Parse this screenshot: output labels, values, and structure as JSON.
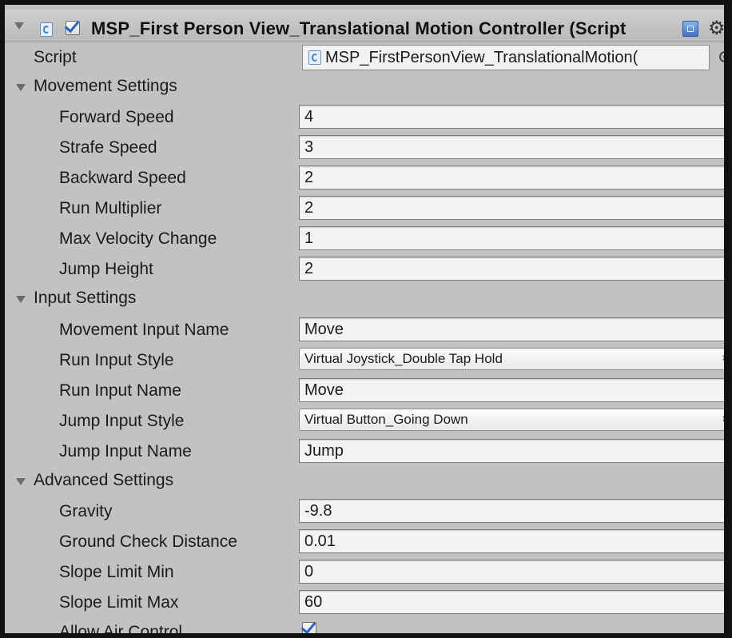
{
  "component": {
    "title": "MSP_First Person View_Translational Motion Controller (Script",
    "enabled": true
  },
  "script_row": {
    "label": "Script",
    "value": "MSP_FirstPersonView_TranslationalMotion("
  },
  "movement": {
    "header": "Movement Settings",
    "forward_speed_label": "Forward Speed",
    "forward_speed": "4",
    "strafe_speed_label": "Strafe Speed",
    "strafe_speed": "3",
    "backward_speed_label": "Backward Speed",
    "backward_speed": "2",
    "run_multiplier_label": "Run Multiplier",
    "run_multiplier": "2",
    "max_velocity_change_label": "Max Velocity Change",
    "max_velocity_change": "1",
    "jump_height_label": "Jump Height",
    "jump_height": "2"
  },
  "input": {
    "header": "Input Settings",
    "movement_input_name_label": "Movement Input Name",
    "movement_input_name": "Move",
    "run_input_style_label": "Run Input Style",
    "run_input_style": "Virtual Joystick_Double Tap Hold",
    "run_input_name_label": "Run Input Name",
    "run_input_name": "Move",
    "jump_input_style_label": "Jump Input Style",
    "jump_input_style": "Virtual Button_Going Down",
    "jump_input_name_label": "Jump Input Name",
    "jump_input_name": "Jump"
  },
  "advanced": {
    "header": "Advanced Settings",
    "gravity_label": "Gravity",
    "gravity": "-9.8",
    "ground_check_distance_label": "Ground Check Distance",
    "ground_check_distance": "0.01",
    "slope_limit_min_label": "Slope Limit Min",
    "slope_limit_min": "0",
    "slope_limit_max_label": "Slope Limit Max",
    "slope_limit_max": "60",
    "allow_air_control_label": "Allow Air Control",
    "allow_air_control": true
  },
  "icons": {
    "component_icon": "script-icon",
    "help_icon": "help-icon",
    "settings_icon": "gear-icon",
    "object_picker_icon": "target-icon",
    "dropdown_icon": "updown-arrows-icon"
  },
  "colors": {
    "panel_bg": "#c2c2c2",
    "field_bg": "#f3f3f3",
    "checkmark": "#2b62c8",
    "frame": "#111111"
  }
}
